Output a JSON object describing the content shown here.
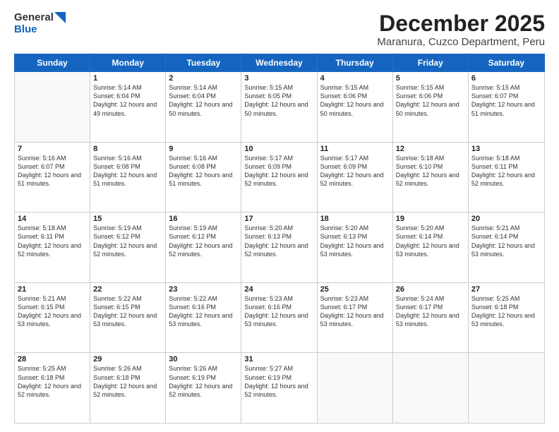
{
  "logo": {
    "line1": "General",
    "line2": "Blue"
  },
  "title": "December 2025",
  "subtitle": "Maranura, Cuzco Department, Peru",
  "days": [
    "Sunday",
    "Monday",
    "Tuesday",
    "Wednesday",
    "Thursday",
    "Friday",
    "Saturday"
  ],
  "rows": [
    [
      {
        "day": "",
        "sunrise": "",
        "sunset": "",
        "daylight": ""
      },
      {
        "day": "1",
        "sunrise": "Sunrise: 5:14 AM",
        "sunset": "Sunset: 6:04 PM",
        "daylight": "Daylight: 12 hours and 49 minutes."
      },
      {
        "day": "2",
        "sunrise": "Sunrise: 5:14 AM",
        "sunset": "Sunset: 6:04 PM",
        "daylight": "Daylight: 12 hours and 50 minutes."
      },
      {
        "day": "3",
        "sunrise": "Sunrise: 5:15 AM",
        "sunset": "Sunset: 6:05 PM",
        "daylight": "Daylight: 12 hours and 50 minutes."
      },
      {
        "day": "4",
        "sunrise": "Sunrise: 5:15 AM",
        "sunset": "Sunset: 6:06 PM",
        "daylight": "Daylight: 12 hours and 50 minutes."
      },
      {
        "day": "5",
        "sunrise": "Sunrise: 5:15 AM",
        "sunset": "Sunset: 6:06 PM",
        "daylight": "Daylight: 12 hours and 50 minutes."
      },
      {
        "day": "6",
        "sunrise": "Sunrise: 5:15 AM",
        "sunset": "Sunset: 6:07 PM",
        "daylight": "Daylight: 12 hours and 51 minutes."
      }
    ],
    [
      {
        "day": "7",
        "sunrise": "Sunrise: 5:16 AM",
        "sunset": "Sunset: 6:07 PM",
        "daylight": "Daylight: 12 hours and 51 minutes."
      },
      {
        "day": "8",
        "sunrise": "Sunrise: 5:16 AM",
        "sunset": "Sunset: 6:08 PM",
        "daylight": "Daylight: 12 hours and 51 minutes."
      },
      {
        "day": "9",
        "sunrise": "Sunrise: 5:16 AM",
        "sunset": "Sunset: 6:08 PM",
        "daylight": "Daylight: 12 hours and 51 minutes."
      },
      {
        "day": "10",
        "sunrise": "Sunrise: 5:17 AM",
        "sunset": "Sunset: 6:09 PM",
        "daylight": "Daylight: 12 hours and 52 minutes."
      },
      {
        "day": "11",
        "sunrise": "Sunrise: 5:17 AM",
        "sunset": "Sunset: 6:09 PM",
        "daylight": "Daylight: 12 hours and 52 minutes."
      },
      {
        "day": "12",
        "sunrise": "Sunrise: 5:18 AM",
        "sunset": "Sunset: 6:10 PM",
        "daylight": "Daylight: 12 hours and 52 minutes."
      },
      {
        "day": "13",
        "sunrise": "Sunrise: 5:18 AM",
        "sunset": "Sunset: 6:11 PM",
        "daylight": "Daylight: 12 hours and 52 minutes."
      }
    ],
    [
      {
        "day": "14",
        "sunrise": "Sunrise: 5:18 AM",
        "sunset": "Sunset: 6:11 PM",
        "daylight": "Daylight: 12 hours and 52 minutes."
      },
      {
        "day": "15",
        "sunrise": "Sunrise: 5:19 AM",
        "sunset": "Sunset: 6:12 PM",
        "daylight": "Daylight: 12 hours and 52 minutes."
      },
      {
        "day": "16",
        "sunrise": "Sunrise: 5:19 AM",
        "sunset": "Sunset: 6:12 PM",
        "daylight": "Daylight: 12 hours and 52 minutes."
      },
      {
        "day": "17",
        "sunrise": "Sunrise: 5:20 AM",
        "sunset": "Sunset: 6:13 PM",
        "daylight": "Daylight: 12 hours and 52 minutes."
      },
      {
        "day": "18",
        "sunrise": "Sunrise: 5:20 AM",
        "sunset": "Sunset: 6:13 PM",
        "daylight": "Daylight: 12 hours and 53 minutes."
      },
      {
        "day": "19",
        "sunrise": "Sunrise: 5:20 AM",
        "sunset": "Sunset: 6:14 PM",
        "daylight": "Daylight: 12 hours and 53 minutes."
      },
      {
        "day": "20",
        "sunrise": "Sunrise: 5:21 AM",
        "sunset": "Sunset: 6:14 PM",
        "daylight": "Daylight: 12 hours and 53 minutes."
      }
    ],
    [
      {
        "day": "21",
        "sunrise": "Sunrise: 5:21 AM",
        "sunset": "Sunset: 6:15 PM",
        "daylight": "Daylight: 12 hours and 53 minutes."
      },
      {
        "day": "22",
        "sunrise": "Sunrise: 5:22 AM",
        "sunset": "Sunset: 6:15 PM",
        "daylight": "Daylight: 12 hours and 53 minutes."
      },
      {
        "day": "23",
        "sunrise": "Sunrise: 5:22 AM",
        "sunset": "Sunset: 6:16 PM",
        "daylight": "Daylight: 12 hours and 53 minutes."
      },
      {
        "day": "24",
        "sunrise": "Sunrise: 5:23 AM",
        "sunset": "Sunset: 6:16 PM",
        "daylight": "Daylight: 12 hours and 53 minutes."
      },
      {
        "day": "25",
        "sunrise": "Sunrise: 5:23 AM",
        "sunset": "Sunset: 6:17 PM",
        "daylight": "Daylight: 12 hours and 53 minutes."
      },
      {
        "day": "26",
        "sunrise": "Sunrise: 5:24 AM",
        "sunset": "Sunset: 6:17 PM",
        "daylight": "Daylight: 12 hours and 53 minutes."
      },
      {
        "day": "27",
        "sunrise": "Sunrise: 5:25 AM",
        "sunset": "Sunset: 6:18 PM",
        "daylight": "Daylight: 12 hours and 53 minutes."
      }
    ],
    [
      {
        "day": "28",
        "sunrise": "Sunrise: 5:25 AM",
        "sunset": "Sunset: 6:18 PM",
        "daylight": "Daylight: 12 hours and 52 minutes."
      },
      {
        "day": "29",
        "sunrise": "Sunrise: 5:26 AM",
        "sunset": "Sunset: 6:18 PM",
        "daylight": "Daylight: 12 hours and 52 minutes."
      },
      {
        "day": "30",
        "sunrise": "Sunrise: 5:26 AM",
        "sunset": "Sunset: 6:19 PM",
        "daylight": "Daylight: 12 hours and 52 minutes."
      },
      {
        "day": "31",
        "sunrise": "Sunrise: 5:27 AM",
        "sunset": "Sunset: 6:19 PM",
        "daylight": "Daylight: 12 hours and 52 minutes."
      },
      {
        "day": "",
        "sunrise": "",
        "sunset": "",
        "daylight": ""
      },
      {
        "day": "",
        "sunrise": "",
        "sunset": "",
        "daylight": ""
      },
      {
        "day": "",
        "sunrise": "",
        "sunset": "",
        "daylight": ""
      }
    ]
  ]
}
